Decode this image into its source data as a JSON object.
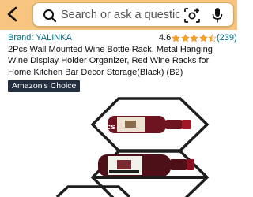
{
  "search": {
    "placeholder": "Search or ask a question"
  },
  "product": {
    "brand": "Brand: YALINKA",
    "rating": "4.6",
    "stars": 4.5,
    "review_count": "(239)",
    "title": "2Pcs Wall Mounted Wine Bottle Rack, Metal Hanging Wine Display Holder Organizer, Red Wine Racks for Home Kitchen Bar Decor Storage(Black) (B2)",
    "badge": "Amazon's Choice",
    "image_label": "2pcs"
  },
  "colors": {
    "header_bg": "#f7c57f",
    "link": "#007185",
    "star": "#ffa41c",
    "badge_bg": "#232f3e",
    "rack": "#1e1e1e",
    "wine": "#7a1622"
  }
}
